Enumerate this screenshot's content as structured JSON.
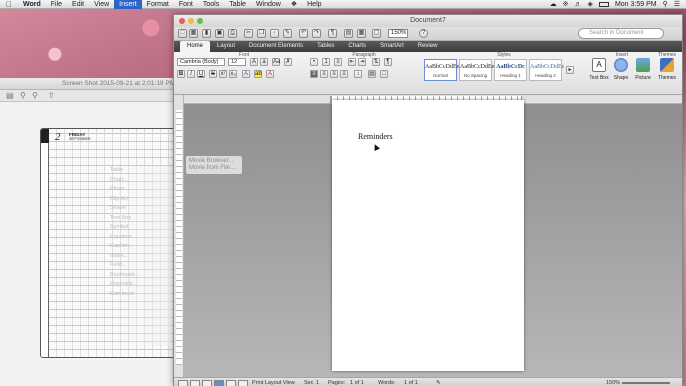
{
  "menubar": {
    "apple": "",
    "items": [
      "Word",
      "File",
      "Edit",
      "View",
      "Insert",
      "Format",
      "Font",
      "Tools",
      "Table",
      "Window",
      "Help"
    ],
    "selected": "Insert",
    "clock": "Mon 3:59 PM"
  },
  "screenshot_window": {
    "title": "Screen Shot 2015-09-21 at 2:01:19 PM",
    "planner": {
      "day_number": "2",
      "day_name": "FRIDAY",
      "month": "SEPTEMBER"
    },
    "faded_items": [
      "Table",
      "Chart...",
      "Photo",
      "Clip Art",
      "Shape",
      "Text Box",
      "Symbol",
      "Equation",
      "Caption...",
      "Index...",
      "Field...",
      "Bookmark...",
      "Hyperlink...",
      "Comment"
    ],
    "dropdown_items": [
      "Movie Browser...",
      "Movie from File..."
    ]
  },
  "word": {
    "title": "Document7",
    "zoom": "150%",
    "search_placeholder": "Search in Document",
    "tabs": [
      "Home",
      "Layout",
      "Document Elements",
      "Tables",
      "Charts",
      "SmartArt",
      "Review"
    ],
    "active_tab": "Home",
    "groups": {
      "font": "Font",
      "paragraph": "Paragraph",
      "styles": "Styles",
      "insert": "Insert",
      "themes": "Themes"
    },
    "font_name": "Cambria (Body)",
    "font_size": "12",
    "styles": [
      {
        "sample": "AaBbCcDdEe",
        "name": "Normal"
      },
      {
        "sample": "AaBbCcDdEe",
        "name": "No Spacing"
      },
      {
        "sample": "AaBbCcDc",
        "name": "Heading 1"
      },
      {
        "sample": "AaBbCcDdEe",
        "name": "Heading 2"
      }
    ],
    "insert_buttons": [
      "Text Box",
      "Shape",
      "Picture"
    ],
    "themes_button": "Themes",
    "document_text": "Reminders",
    "status": {
      "view": "Print Layout View",
      "sec_label": "Sec",
      "sec_value": "1",
      "pages_label": "Pages:",
      "pages_value": "1 of 1",
      "words_label": "Words:",
      "words_value": "1 of 1",
      "zoom": "150%"
    }
  },
  "colors": {
    "menu_highlight": "#2e63c7",
    "ribbon_tabs_bg": "#4a4a4a",
    "canvas_gray": "#a3a3a3"
  }
}
